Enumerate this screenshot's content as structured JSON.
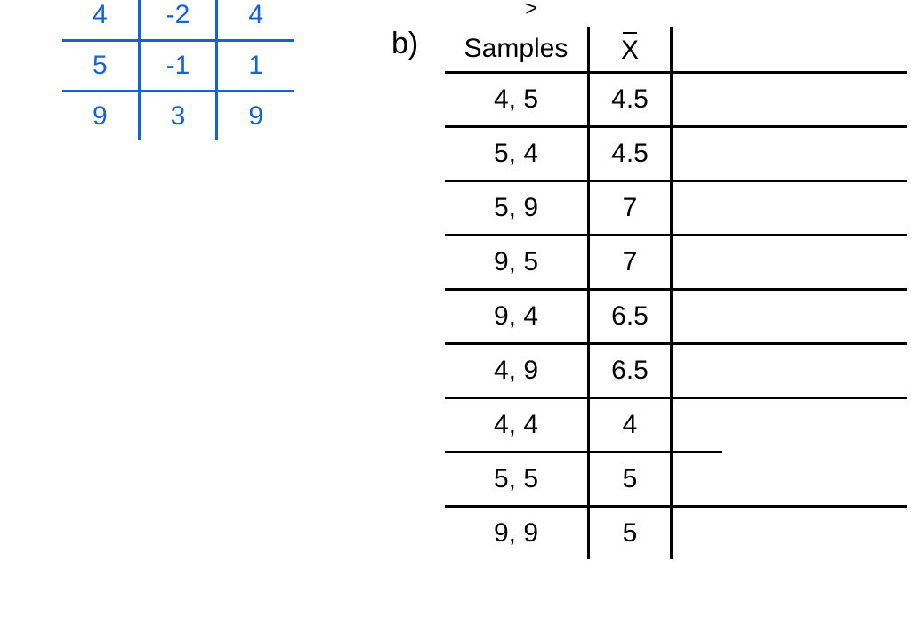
{
  "left_grid": {
    "rows": [
      [
        "4",
        "-2",
        "4"
      ],
      [
        "5",
        "-1",
        "1"
      ],
      [
        "9",
        "3",
        "9"
      ]
    ]
  },
  "part_label": "b)",
  "stray_mark": ">",
  "samples_table": {
    "header": {
      "col1": "Samples",
      "col2": "x̄"
    },
    "rows": [
      {
        "sample": "4, 5",
        "xbar": "4.5",
        "full": true
      },
      {
        "sample": "5, 4",
        "xbar": "4.5",
        "full": true
      },
      {
        "sample": "5, 9",
        "xbar": "7",
        "full": true
      },
      {
        "sample": "9, 5",
        "xbar": "7",
        "full": true
      },
      {
        "sample": "9, 4",
        "xbar": "6.5",
        "full": true
      },
      {
        "sample": "4, 9",
        "xbar": "6.5",
        "full": true
      },
      {
        "sample": "4, 4",
        "xbar": "4",
        "full": false
      },
      {
        "sample": "5, 5",
        "xbar": "5",
        "full": true
      },
      {
        "sample": "9, 9",
        "xbar": "5",
        "full": false
      }
    ]
  }
}
